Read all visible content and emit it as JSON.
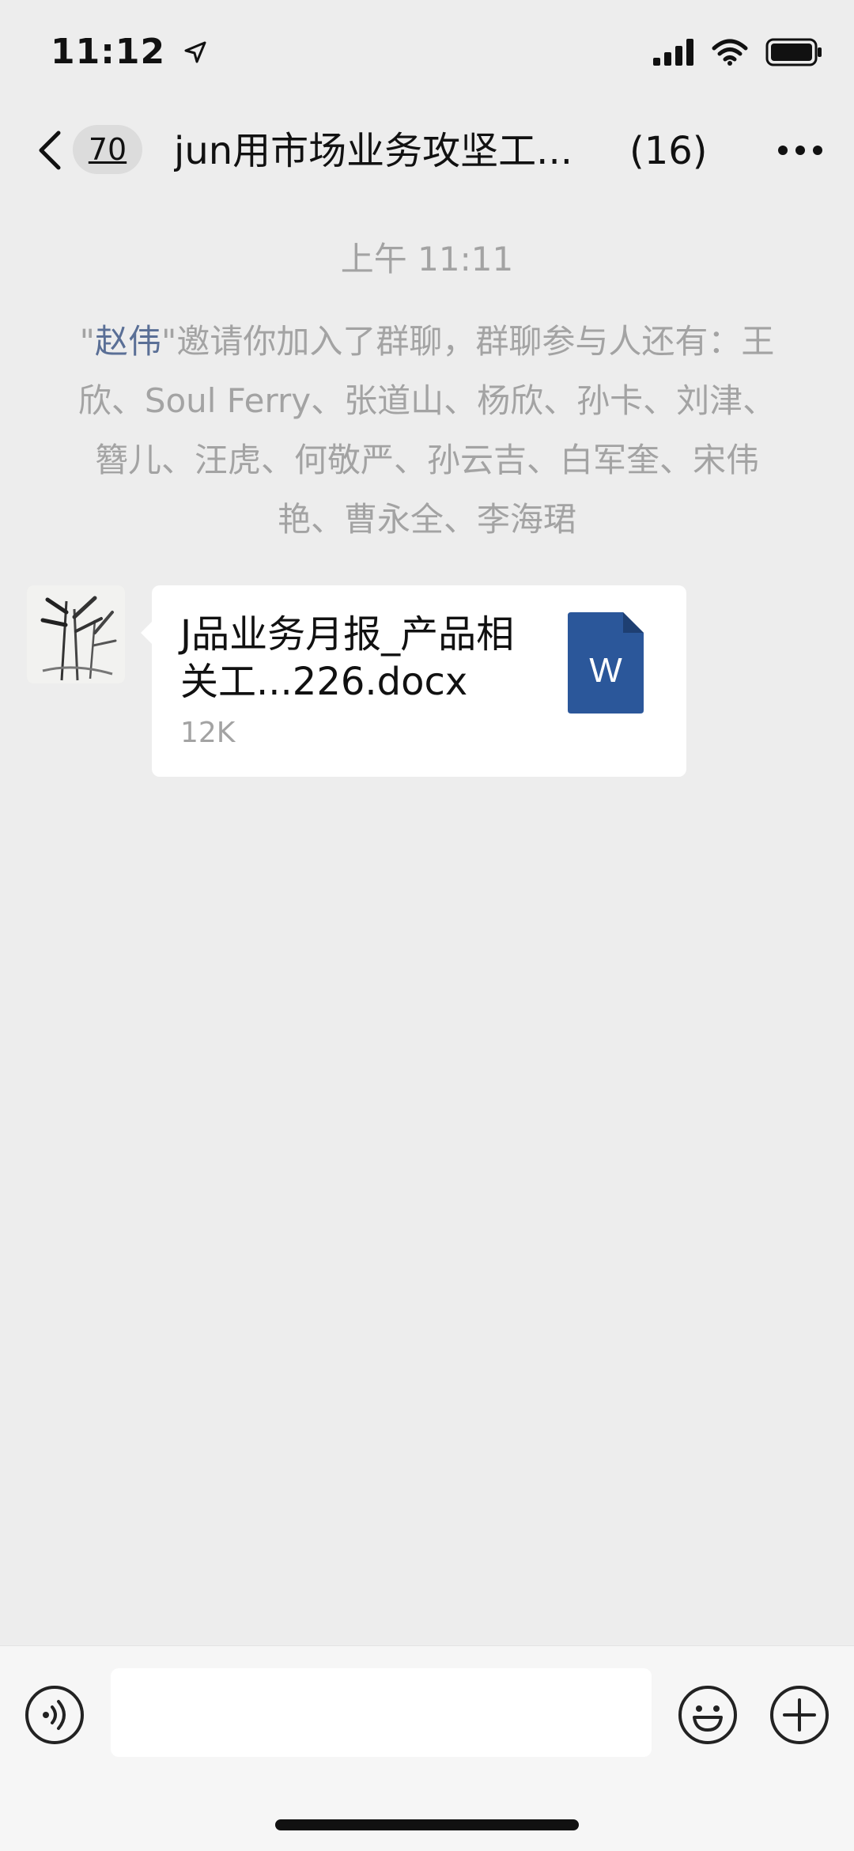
{
  "status_bar": {
    "time": "11:12",
    "location_icon": "location-arrow-icon",
    "signal_icon": "cellular-signal-icon",
    "wifi_icon": "wifi-icon",
    "battery_icon": "battery-icon"
  },
  "header": {
    "back_icon": "chevron-left-icon",
    "unread_count": "70",
    "title": "jun用市场业务攻坚工...",
    "member_count": "(16)",
    "more_icon": "more-dots-icon"
  },
  "chat": {
    "system_time": "上午 11:11",
    "invite_quote_open": "\"",
    "invite_name": "赵伟",
    "invite_text": "\"邀请你加入了群聊，群聊参与人还有：王欣、Soul Ferry、张道山、杨欣、孙卡、刘津、簪儿、汪虎、何敬严、孙云吉、白军奎、宋伟艳、曹永全、李海珺",
    "messages": [
      {
        "type": "file",
        "file_name": "J品业务月报_产品相关工...226.docx",
        "file_size": "12K",
        "file_icon_letter": "W",
        "file_icon": "word-document-icon",
        "file_icon_color": "#2b579a"
      }
    ]
  },
  "input_bar": {
    "voice_icon": "voice-icon",
    "emoji_icon": "emoji-icon",
    "plus_icon": "plus-icon",
    "text_value": ""
  },
  "colors": {
    "background": "#ededed",
    "system_text": "#a3a3a3",
    "name_link": "#5a6f96"
  }
}
